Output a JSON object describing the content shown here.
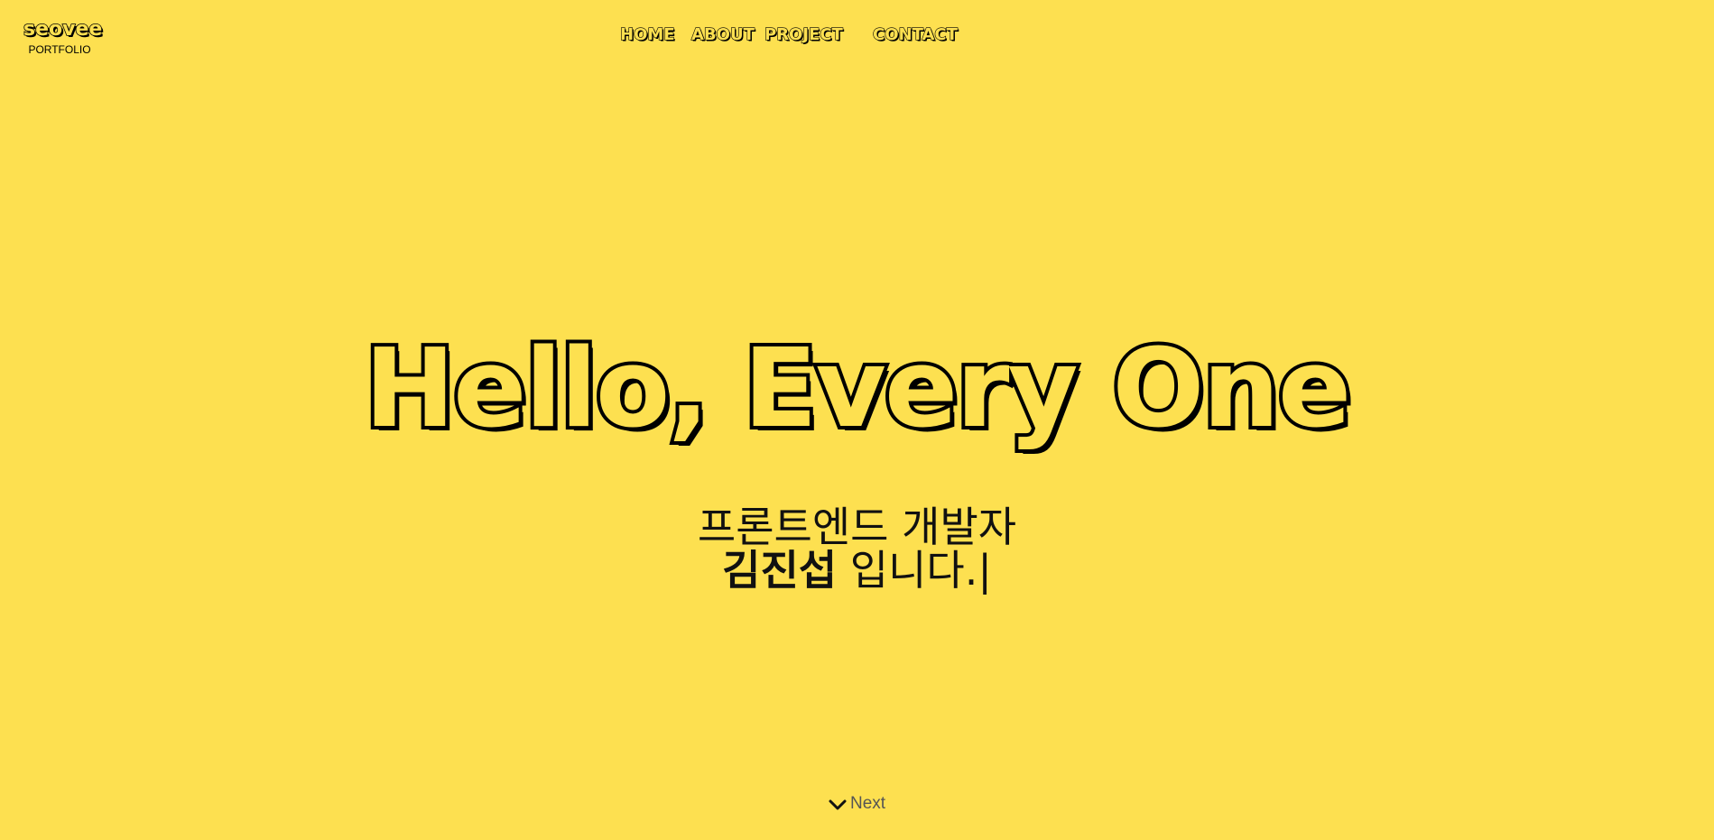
{
  "brand": {
    "name": "seovee",
    "tagline": "PORTFOLIO"
  },
  "nav": {
    "items": [
      {
        "label": "HOME"
      },
      {
        "label": "ABOUT"
      },
      {
        "label": "PROJECT"
      },
      {
        "label": "CONTACT"
      }
    ]
  },
  "hero": {
    "title": "Hello, Every One",
    "subtitle_line1": "프론트엔드 개발자",
    "name": "김진섭",
    "subtitle_suffix": " 입니다.",
    "cursor": "|"
  },
  "scroll": {
    "label": "Next",
    "icon": "chevron-down-icon"
  },
  "colors": {
    "background": "#fde050",
    "text": "#111111",
    "outline": "#000000"
  }
}
